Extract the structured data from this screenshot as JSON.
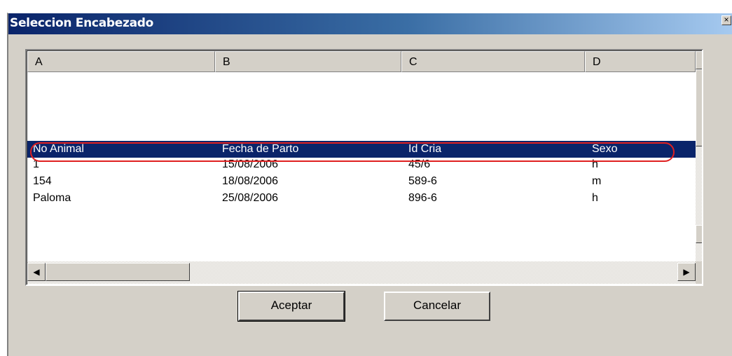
{
  "window": {
    "title": "Seleccion Encabezado",
    "close_glyph": "×"
  },
  "grid": {
    "columns": [
      "A",
      "B",
      "C",
      "D"
    ],
    "rows": [
      [
        "",
        "",
        "",
        ""
      ],
      [
        "",
        "",
        "",
        ""
      ],
      [
        "No Animal",
        "Fecha de Parto",
        "Id Cria",
        "Sexo"
      ],
      [
        "1",
        "15/08/2006",
        "45/6",
        "h"
      ],
      [
        "154",
        "18/08/2006",
        "589-6",
        "m"
      ],
      [
        "Paloma",
        "25/08/2006",
        "896-6",
        "h"
      ]
    ],
    "selected_row_index": 2,
    "selection_color": "#0a246a",
    "highlight_outline_color": "#e02020"
  },
  "scrollbars": {
    "up_arrow": "▲",
    "down_arrow": "▼",
    "left_arrow": "◀",
    "right_arrow": "▶"
  },
  "buttons": {
    "accept_label": "Aceptar",
    "cancel_label": "Cancelar"
  }
}
